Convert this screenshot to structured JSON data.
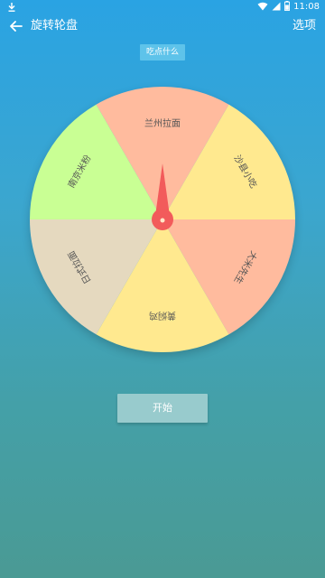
{
  "status_bar": {
    "time": "11:08",
    "icons": [
      "download-icon",
      "wifi-icon",
      "signal-icon",
      "battery-icon"
    ]
  },
  "app_bar": {
    "title": "旋转轮盘",
    "action_label": "选项",
    "back_icon": "arrow-left-icon"
  },
  "question": {
    "label": "吃点什么"
  },
  "wheel": {
    "segments": [
      {
        "label": "兰州拉面",
        "color": "#ffbb9e"
      },
      {
        "label": "沙县小吃",
        "color": "#ffe98f"
      },
      {
        "label": "大米先生",
        "color": "#ffbb9e"
      },
      {
        "label": "黄焖鸡",
        "color": "#ffe98f"
      },
      {
        "label": "日式拉面",
        "color": "#e5d9bf"
      },
      {
        "label": "南京米粉",
        "color": "#c9ff94"
      }
    ],
    "pointer_color": "#f25b5b"
  },
  "start_button": {
    "label": "开始"
  },
  "colors": {
    "bg_top": "#2aa3e3",
    "bg_bottom": "#4a9a94",
    "chip": "#5ec3ea",
    "button": "#98cbcd"
  }
}
